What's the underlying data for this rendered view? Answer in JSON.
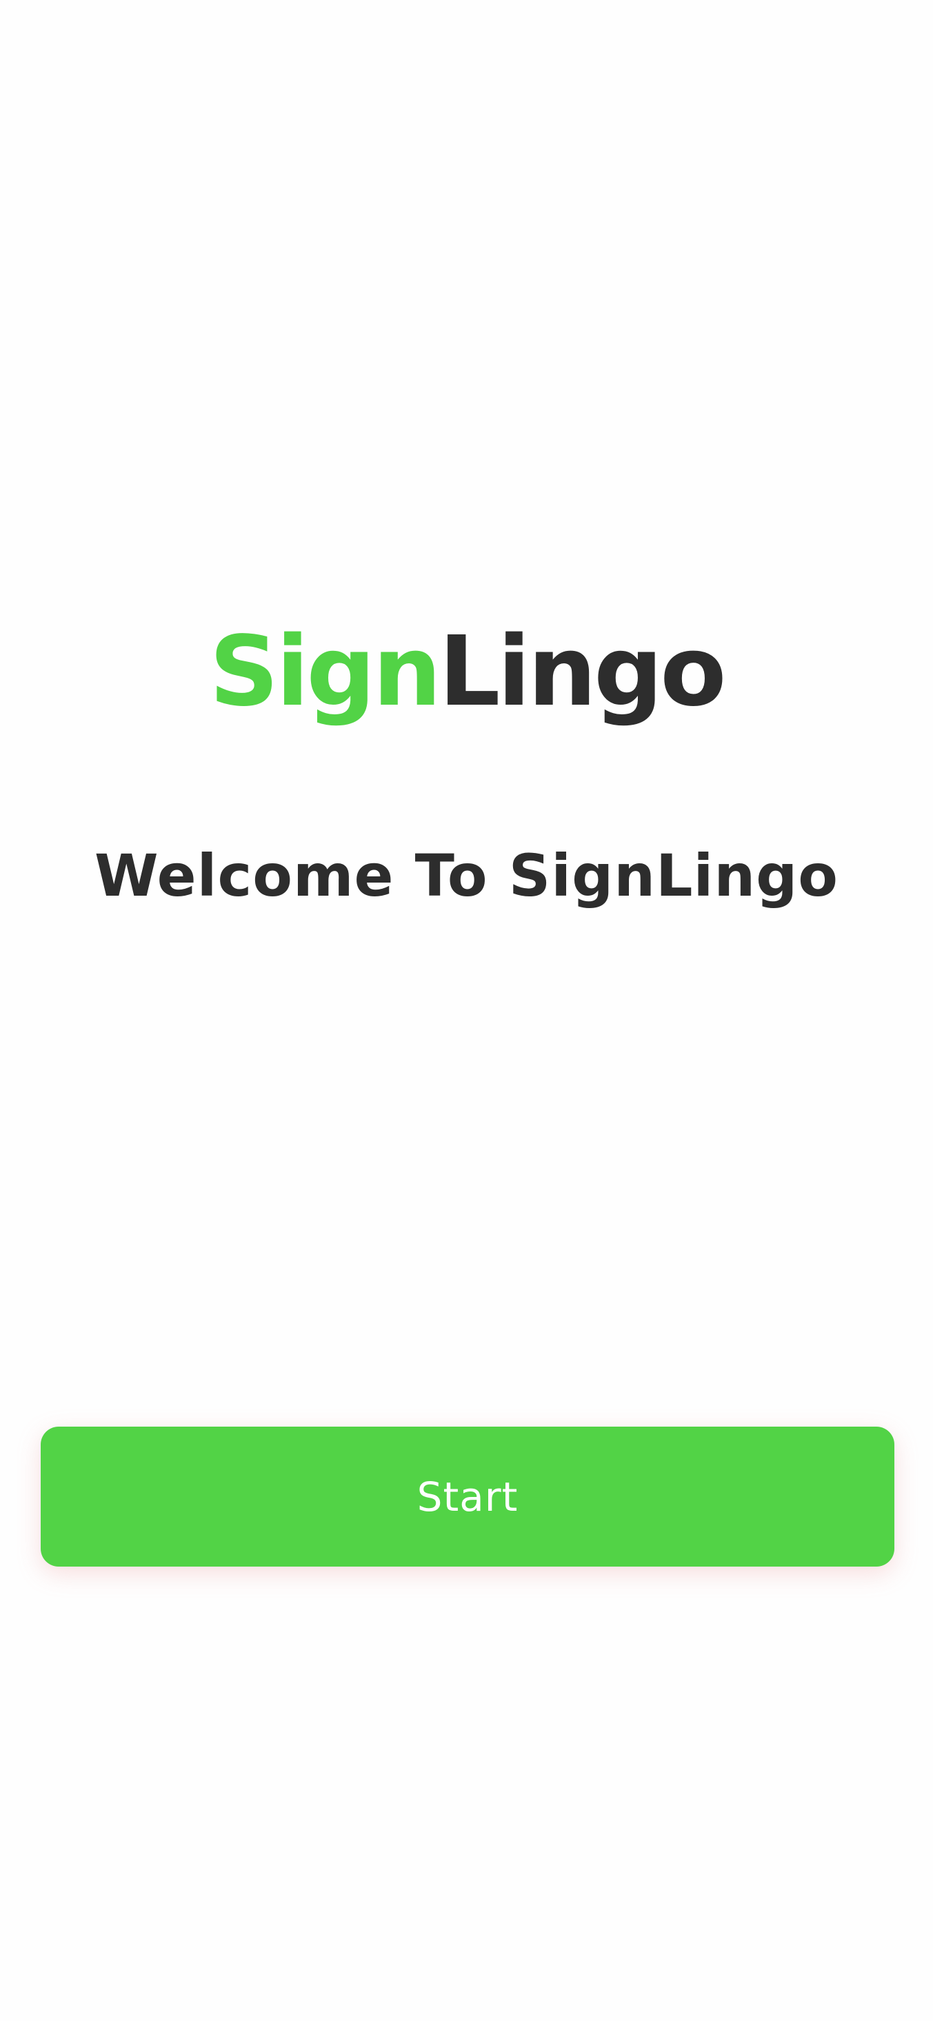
{
  "app": {
    "logo_part_1": "Sign",
    "logo_part_2": "Lingo",
    "welcome_text": "Welcome To SignLingo"
  },
  "actions": {
    "start_label": "Start"
  },
  "colors": {
    "accent": "#52d346",
    "text_dark": "#2d2d2d",
    "background": "#fefefe",
    "button_text": "#ffffff"
  }
}
